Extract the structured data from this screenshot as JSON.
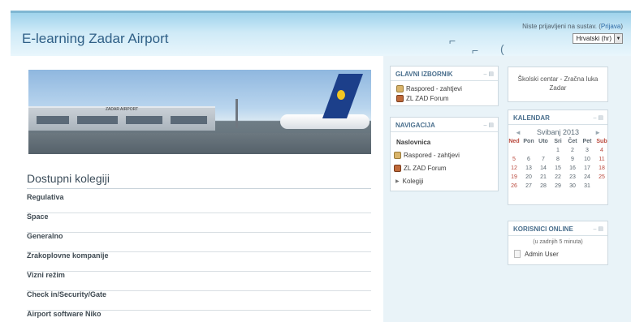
{
  "header": {
    "title": "E-learning Zadar Airport",
    "login_text": "Niste prijavljeni na sustav. (",
    "login_link": "Prijava",
    "login_close": ")",
    "language": "Hrvatski (hr)"
  },
  "main": {
    "courses_heading": "Dostupni kolegiji",
    "courses": [
      "Regulativa",
      "Space",
      "Generalno",
      "Zrakoplovne kompanije",
      "Vizni režim",
      "Check in/Security/Gate",
      "Airport software Niko"
    ]
  },
  "blocks": {
    "main_menu": {
      "title": "GLAVNI IZBORNIK",
      "items": [
        {
          "label": "Raspored - zahtjevi",
          "icon": "schedule-icon"
        },
        {
          "label": "ZL ZAD Forum",
          "icon": "forum-icon"
        }
      ]
    },
    "navigation": {
      "title": "NAVIGACIJA",
      "home": "Naslovnica",
      "items": [
        {
          "label": "Raspored - zahtjevi",
          "icon": "schedule-icon"
        },
        {
          "label": "ZL ZAD Forum",
          "icon": "forum-icon"
        },
        {
          "label": "Kolegiji",
          "icon": "triangle-right-icon"
        }
      ]
    },
    "school": {
      "text": "Školski centar - Zračna luka Zadar"
    },
    "calendar": {
      "title": "KALENDAR",
      "month": "Svibanj 2013",
      "prev": "◄",
      "next": "►",
      "day_headers": [
        "Ned",
        "Pon",
        "Uto",
        "Sri",
        "Čet",
        "Pet",
        "Sub"
      ],
      "weeks": [
        [
          "",
          "",
          "",
          "1",
          "2",
          "3",
          "4"
        ],
        [
          "5",
          "6",
          "7",
          "8",
          "9",
          "10",
          "11"
        ],
        [
          "12",
          "13",
          "14",
          "15",
          "16",
          "17",
          "18"
        ],
        [
          "19",
          "20",
          "21",
          "22",
          "23",
          "24",
          "25"
        ],
        [
          "26",
          "27",
          "28",
          "29",
          "30",
          "31",
          ""
        ]
      ]
    },
    "online": {
      "title": "KORISNICI ONLINE",
      "subtitle": "(u zadnjih 5 minuta)",
      "users": [
        "Admin User"
      ]
    }
  },
  "banner": {
    "terminal_sign": "ZADAR AIRPORT"
  }
}
